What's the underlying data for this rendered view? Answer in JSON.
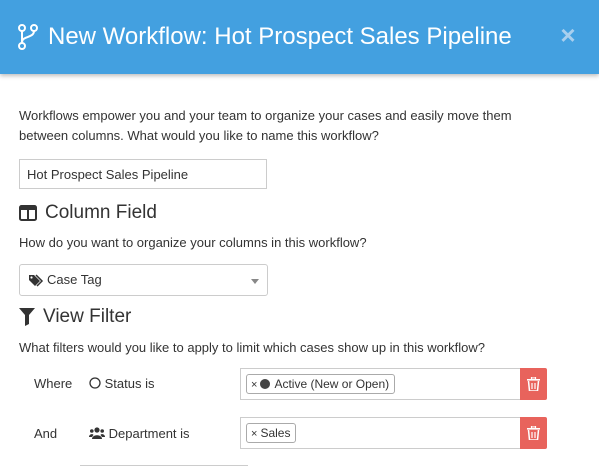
{
  "header": {
    "title": "New Workflow: Hot Prospect Sales Pipeline",
    "close_label": "×"
  },
  "intro": {
    "text": "Workflows empower you and your team to organize your cases and easily move them between columns. What would you like to name this workflow?"
  },
  "name_field": {
    "value": "Hot Prospect Sales Pipeline"
  },
  "column_field": {
    "heading": "Column Field",
    "question": "How do you want to organize your columns in this workflow?",
    "selected": "Case Tag"
  },
  "view_filter": {
    "heading": "View Filter",
    "question": "What filters would you like to apply to limit which cases show up in this workflow?",
    "rows": [
      {
        "conjunction": "Where",
        "field": "Status is",
        "chips": [
          "Active (New or Open)"
        ]
      },
      {
        "conjunction": "And",
        "field": "Department is",
        "chips": [
          "Sales"
        ]
      }
    ],
    "chip_remove": "×"
  },
  "icons": {
    "header": "workflow-branch-icon",
    "close": "close-icon",
    "column": "columns-icon",
    "filter": "filter-icon",
    "tag": "tags-icon",
    "status": "circle-outline-icon",
    "department": "users-icon",
    "trash": "trash-icon"
  },
  "colors": {
    "header_bg": "#43a0e0",
    "delete_bg": "#e8635c"
  }
}
